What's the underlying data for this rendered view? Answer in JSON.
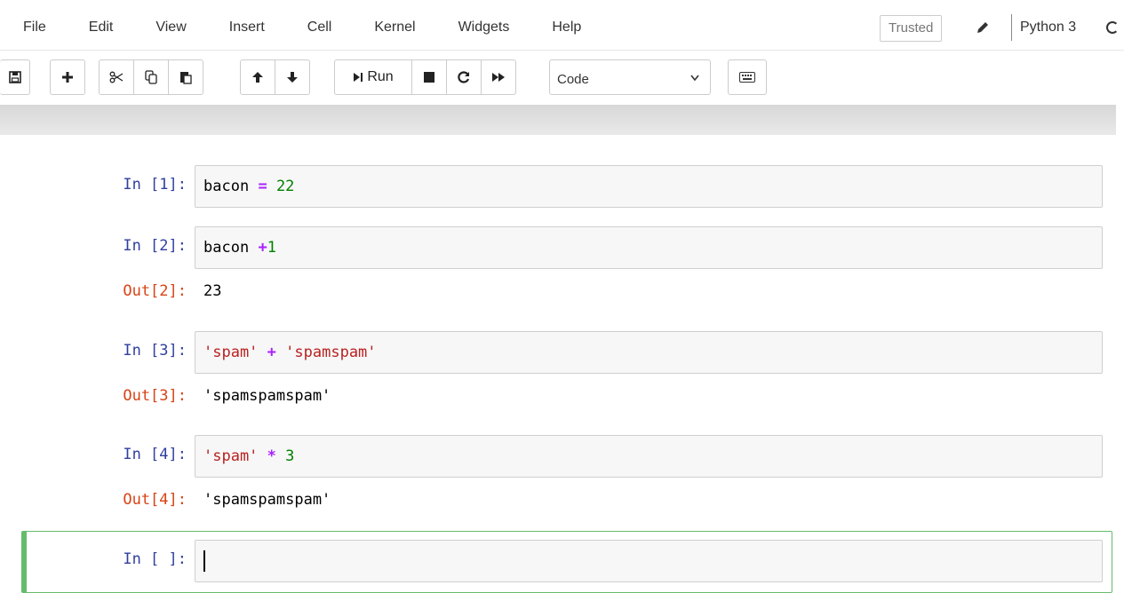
{
  "menubar": {
    "items": [
      "File",
      "Edit",
      "View",
      "Insert",
      "Cell",
      "Kernel",
      "Widgets",
      "Help"
    ],
    "trusted_label": "Trusted",
    "kernel_name": "Python 3"
  },
  "toolbar": {
    "buttons": [
      {
        "icon": "save-icon"
      },
      {
        "icon": "plus-icon"
      },
      {
        "icon": "cut-icon"
      },
      {
        "icon": "copy-icon"
      },
      {
        "icon": "paste-icon"
      },
      {
        "icon": "arrow-up-icon"
      },
      {
        "icon": "arrow-down-icon"
      },
      {
        "icon": "run-icon",
        "label": "Run"
      },
      {
        "icon": "stop-icon"
      },
      {
        "icon": "restart-icon"
      },
      {
        "icon": "fast-forward-icon"
      },
      {
        "icon": "keyboard-icon"
      }
    ],
    "run_label": "Run",
    "cell_type_selected": "Code"
  },
  "cells": [
    {
      "in_prompt": "In [1]:",
      "tokens": [
        {
          "t": "bacon",
          "k": "var"
        },
        {
          "t": " ",
          "k": "sp"
        },
        {
          "t": "=",
          "k": "op"
        },
        {
          "t": " ",
          "k": "sp"
        },
        {
          "t": "22",
          "k": "num"
        }
      ],
      "out_prompt": "",
      "output": ""
    },
    {
      "in_prompt": "In [2]:",
      "tokens": [
        {
          "t": "bacon",
          "k": "var"
        },
        {
          "t": " ",
          "k": "sp"
        },
        {
          "t": "+",
          "k": "op"
        },
        {
          "t": "1",
          "k": "num"
        }
      ],
      "out_prompt": "Out[2]:",
      "output": "23"
    },
    {
      "in_prompt": "In [3]:",
      "tokens": [
        {
          "t": "'spam'",
          "k": "str"
        },
        {
          "t": " ",
          "k": "sp"
        },
        {
          "t": "+",
          "k": "op"
        },
        {
          "t": " ",
          "k": "sp"
        },
        {
          "t": "'spamspam'",
          "k": "str"
        }
      ],
      "out_prompt": "Out[3]:",
      "output": "'spamspamspam'"
    },
    {
      "in_prompt": "In [4]:",
      "tokens": [
        {
          "t": "'spam'",
          "k": "str"
        },
        {
          "t": " ",
          "k": "sp"
        },
        {
          "t": "*",
          "k": "op"
        },
        {
          "t": " ",
          "k": "sp"
        },
        {
          "t": "3",
          "k": "num"
        }
      ],
      "out_prompt": "Out[4]:",
      "output": "'spamspamspam'"
    },
    {
      "in_prompt": "In [ ]:",
      "tokens": [],
      "out_prompt": "",
      "output": ""
    }
  ],
  "colors": {
    "in_prompt": "#303f9f",
    "out_prompt": "#d84315",
    "selected_border": "#66bb6a",
    "keyword_op": "#aa22ff",
    "number": "#008000",
    "string": "#ba2121"
  }
}
